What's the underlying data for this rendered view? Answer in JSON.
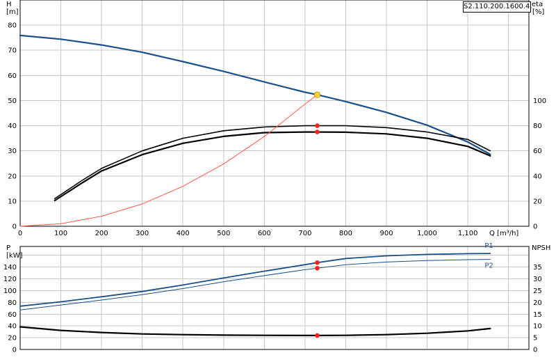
{
  "pump_id": "S2.110.200.1600.4.",
  "chart_data": [
    {
      "type": "line",
      "panel": "head-efficiency",
      "xlabel": "Q [m³/h]",
      "ylabel_left": "H",
      "ylabel_left_unit": "[m]",
      "ylabel_right": "eta",
      "ylabel_right_unit": "[%]",
      "xlim": [
        0,
        1250
      ],
      "ylim_left": [
        0,
        90
      ],
      "ylim_right": [
        0,
        180
      ],
      "x_ticks": [
        "0",
        "100",
        "200",
        "300",
        "400",
        "500",
        "600",
        "700",
        "800",
        "900",
        "1,000",
        "1,100"
      ],
      "y_left_ticks": [
        "0",
        "10",
        "20",
        "30",
        "40",
        "50",
        "60",
        "70",
        "80"
      ],
      "y_right_ticks": [
        "0",
        "20",
        "40",
        "60",
        "80",
        "100"
      ],
      "grid": true,
      "series": [
        {
          "key": "H",
          "axis": "left",
          "color": "#1a4f8a",
          "width": 2.2,
          "x": [
            0,
            100,
            200,
            300,
            400,
            500,
            600,
            700,
            730,
            800,
            900,
            1000,
            1100,
            1155
          ],
          "y": [
            75.9,
            74.4,
            72.1,
            69.2,
            65.5,
            61.6,
            57.4,
            53.3,
            52.3,
            49.6,
            45.3,
            40.2,
            33.5,
            28.6
          ]
        },
        {
          "key": "eta_upper",
          "axis": "right",
          "color": "#000000",
          "width": 1.6,
          "x": [
            85,
            150,
            200,
            300,
            400,
            500,
            600,
            700,
            730,
            800,
            900,
            1000,
            1100,
            1155
          ],
          "y": [
            22,
            36,
            46,
            60,
            70,
            76,
            79,
            80,
            80,
            80,
            78.5,
            75,
            69,
            60
          ]
        },
        {
          "key": "eta_lower",
          "axis": "right",
          "color": "#000000",
          "width": 2.2,
          "x": [
            85,
            150,
            200,
            300,
            400,
            500,
            600,
            700,
            730,
            800,
            900,
            1000,
            1100,
            1155
          ],
          "y": [
            20.5,
            34,
            44,
            57,
            66,
            71.5,
            74.5,
            75,
            75,
            74.8,
            73.5,
            70,
            63.5,
            56
          ]
        },
        {
          "key": "system",
          "axis": "left",
          "color": "#ff5a4a",
          "width": 1,
          "x": [
            0,
            100,
            200,
            300,
            400,
            500,
            600,
            700,
            730
          ],
          "y": [
            0,
            1.0,
            4.0,
            8.9,
            15.9,
            24.8,
            35.7,
            48.6,
            52.3
          ]
        }
      ],
      "operating_points": [
        {
          "x": 730,
          "y": 52.3,
          "axis": "left",
          "color": "#ffd43b"
        },
        {
          "x": 730,
          "y": 80,
          "axis": "right",
          "color": "#ff2020"
        },
        {
          "x": 730,
          "y": 75,
          "axis": "right",
          "color": "#ff2020"
        }
      ]
    },
    {
      "type": "line",
      "panel": "power-npsh",
      "ylabel_left": "P",
      "ylabel_left_unit": "[kW]",
      "ylabel_right": "NPSH",
      "ylim_left": [
        0,
        175
      ],
      "ylim_right": [
        0,
        43.75
      ],
      "xlim": [
        0,
        1250
      ],
      "y_left_ticks": [
        "0",
        "20",
        "40",
        "60",
        "80",
        "100",
        "120",
        "140"
      ],
      "y_right_ticks": [
        "0",
        "5",
        "10",
        "15",
        "20",
        "25",
        "30",
        "35"
      ],
      "grid": true,
      "series": [
        {
          "name": "P1",
          "axis": "left",
          "color": "#1a4f8a",
          "width": 1.8,
          "x": [
            0,
            100,
            200,
            300,
            400,
            500,
            600,
            700,
            730,
            800,
            900,
            1000,
            1100,
            1155
          ],
          "y": [
            73.5,
            81,
            89.5,
            98.5,
            109.5,
            121.5,
            133,
            144,
            147.5,
            154.5,
            159,
            161.5,
            162.7,
            163
          ]
        },
        {
          "name": "P2",
          "axis": "left",
          "color": "#1a4f8a",
          "width": 1,
          "x": [
            0,
            100,
            200,
            300,
            400,
            500,
            600,
            700,
            730,
            800,
            900,
            1000,
            1100,
            1155
          ],
          "y": [
            67,
            75.5,
            84,
            93,
            103.5,
            115,
            125.5,
            135.5,
            138,
            144,
            148.5,
            151,
            152.5,
            153
          ]
        },
        {
          "key": "NPSH",
          "axis": "right",
          "color": "#000000",
          "width": 2.2,
          "x": [
            0,
            100,
            200,
            300,
            400,
            500,
            600,
            700,
            730,
            800,
            900,
            1000,
            1100,
            1155
          ],
          "y": [
            9.6,
            8.1,
            7.2,
            6.6,
            6.3,
            6.1,
            6.0,
            5.95,
            5.95,
            6.0,
            6.3,
            6.9,
            7.9,
            8.9
          ]
        }
      ],
      "operating_points": [
        {
          "x": 730,
          "y": 147.5,
          "axis": "left",
          "color": "#ff2020"
        },
        {
          "x": 730,
          "y": 138,
          "axis": "left",
          "color": "#ff2020"
        },
        {
          "x": 730,
          "y": 5.95,
          "axis": "right",
          "color": "#ff2020"
        }
      ]
    }
  ]
}
